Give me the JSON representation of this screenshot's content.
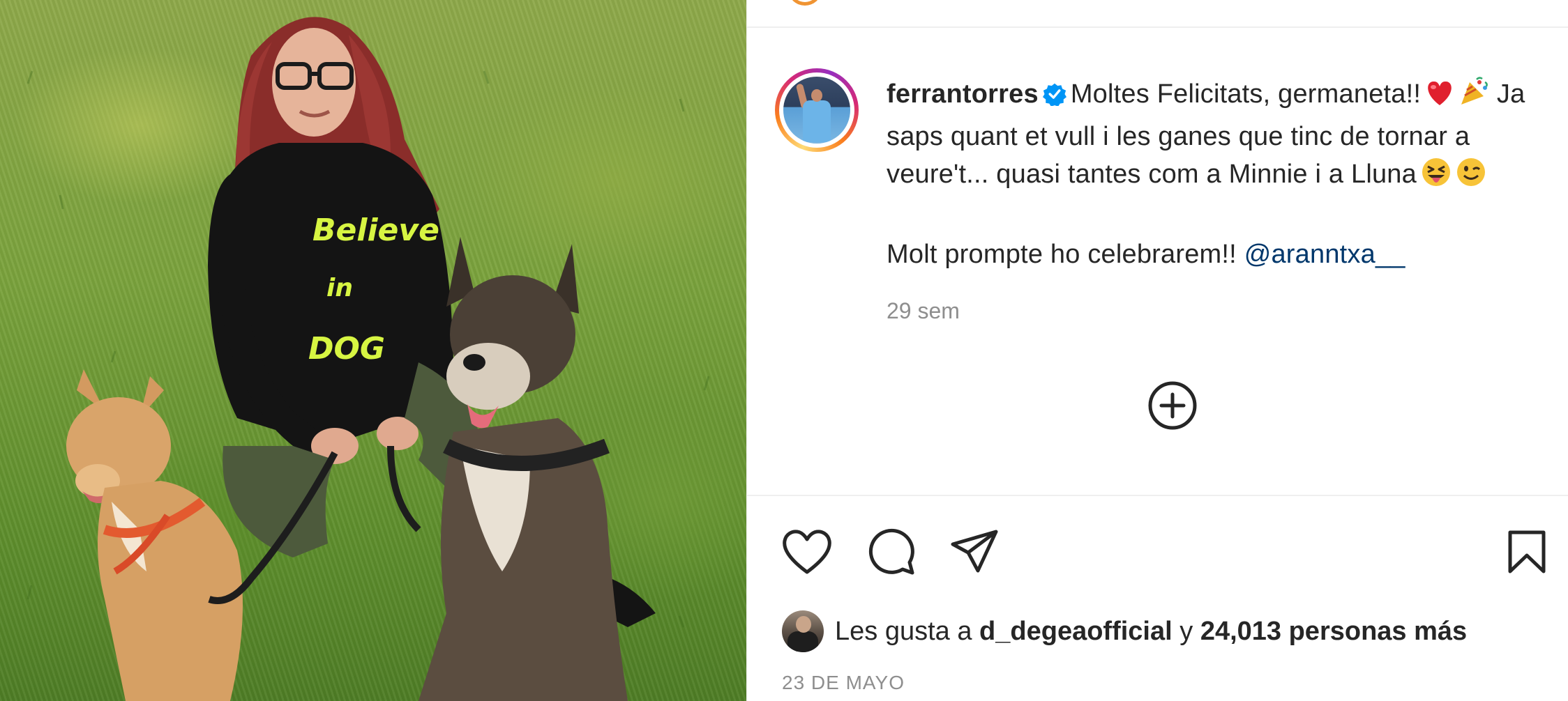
{
  "post": {
    "photo_alt": "",
    "author": {
      "username": "ferrantorres",
      "verified": true
    },
    "caption": {
      "line1": "Moltes Felicitats, germaneta!!",
      "line1_emojis": [
        "red-heart",
        "party-popper"
      ],
      "line2": "Ja saps quant et vull i les ganes que tinc de tornar a veure't... quasi tantes com a Minnie i a Lluna",
      "line2_emojis": [
        "squinting-face-with-tongue",
        "winking-face"
      ],
      "line3": "Molt prompte ho celebrarem!!",
      "mention": "@aranntxa__"
    },
    "time_ago": "29 sem",
    "likes": {
      "prefix": "Les gusta a",
      "liker": "d_degeaofficial",
      "conjunction": "y",
      "others": "24,013 personas más"
    },
    "date": "23 DE MAYO",
    "colors": {
      "accent_link": "#00376b",
      "verified": "#0095f6",
      "muted": "#8e8e8e",
      "text": "#262626"
    },
    "icons": [
      "verified-badge",
      "add-circle-icon",
      "heart-icon",
      "comment-icon",
      "share-icon",
      "bookmark-icon"
    ]
  }
}
